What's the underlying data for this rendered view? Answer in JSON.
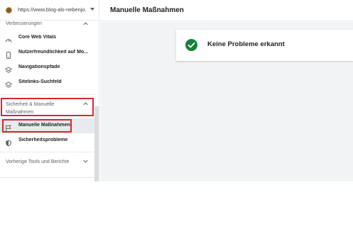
{
  "property": {
    "url": "https://www.blog-als-nebenjo..."
  },
  "sidebar": {
    "section_improvements": "Verbesserungen",
    "items_improvements": [
      {
        "label": "Core Web Vitals",
        "icon": "gauge-icon"
      },
      {
        "label": "Nutzerfreundlichkeit auf Mo...",
        "icon": "smartphone-icon"
      },
      {
        "label": "Navigationspfade",
        "icon": "layers-icon"
      },
      {
        "label": "Sitelinks-Suchfeld",
        "icon": "layers-icon"
      }
    ],
    "section_security": "Sicherheit & Manuelle Maßnahmen",
    "items_security": [
      {
        "label": "Manuelle Maßnahmen",
        "icon": "flag-icon"
      },
      {
        "label": "Sicherheitsprobleme",
        "icon": "shield-icon"
      }
    ],
    "section_legacy": "Vorherige Tools und Berichte"
  },
  "header": {
    "title": "Manuelle Maßnahmen"
  },
  "status_card": {
    "message": "Keine Probleme erkannt",
    "icon": "check-circle-icon"
  },
  "colors": {
    "accent_green": "#188038",
    "highlight_red": "#d9262c",
    "content_bg": "#f1f3f4"
  }
}
